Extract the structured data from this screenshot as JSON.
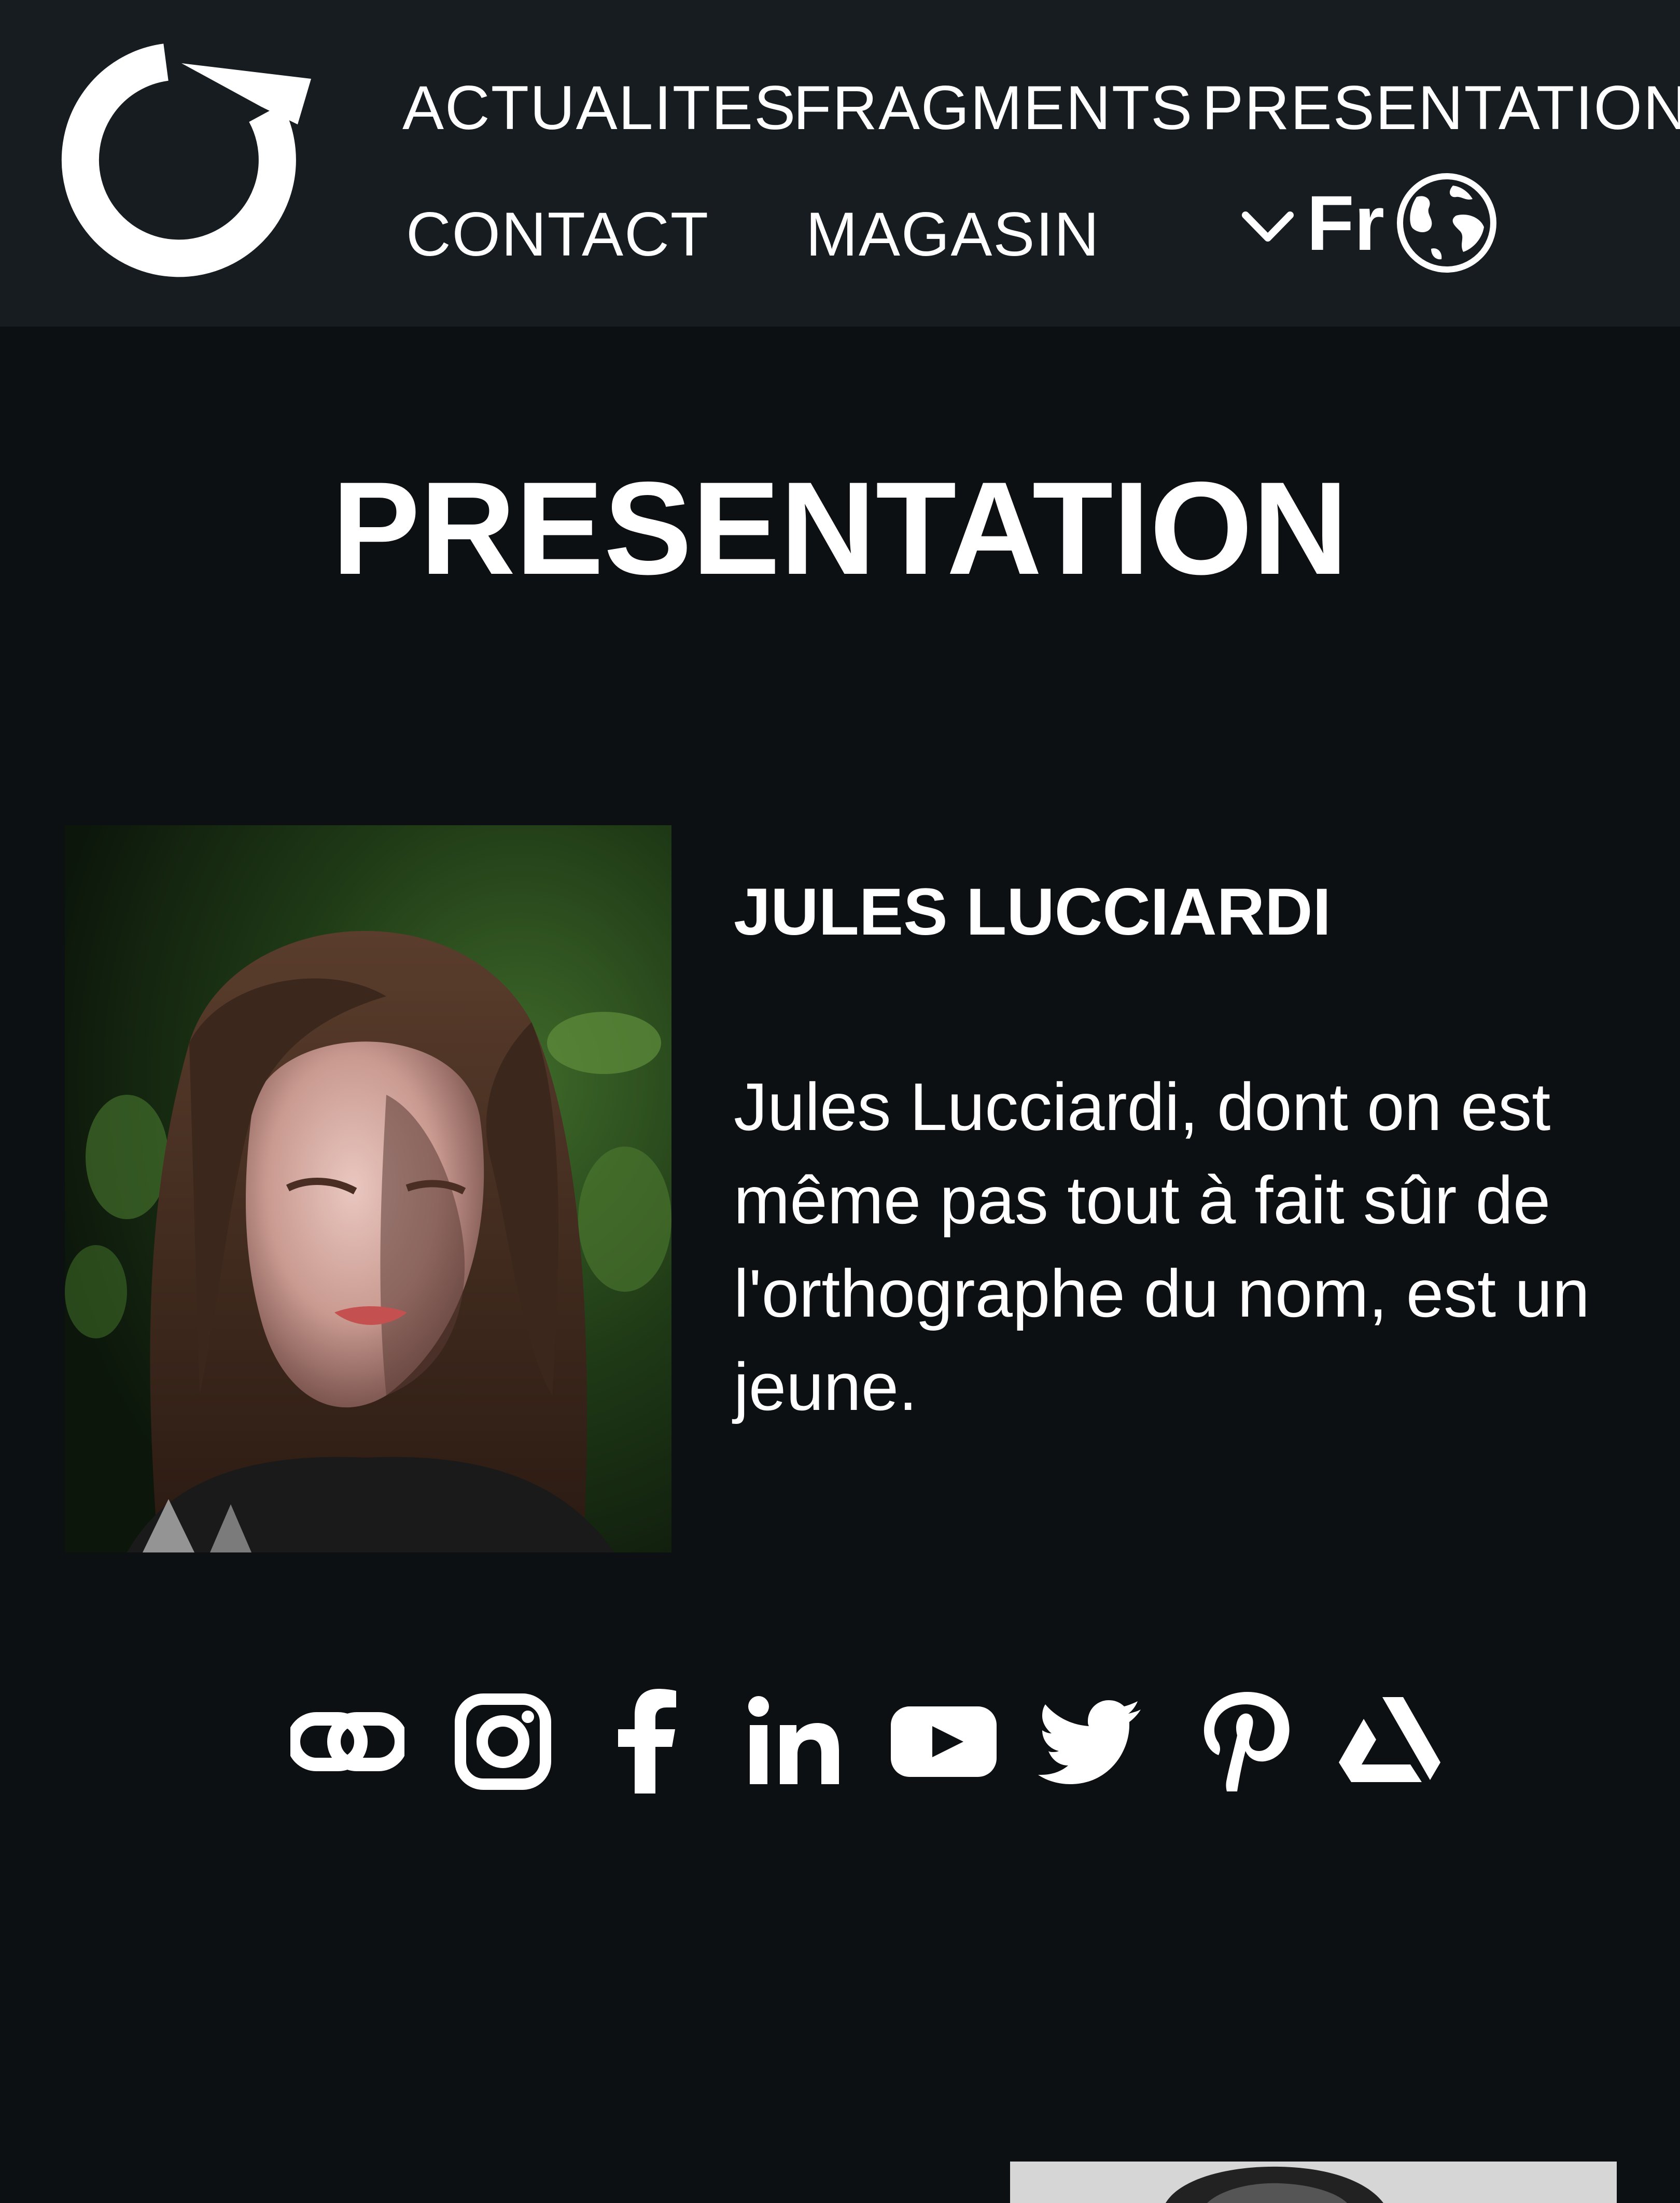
{
  "header": {
    "logo_name": "site-logo",
    "nav": [
      {
        "label": "ACTUALITES"
      },
      {
        "label": "FRAGMENTS"
      },
      {
        "label": "PRESENTATION"
      },
      {
        "label": "CONTACT"
      },
      {
        "label": "MAGASIN"
      }
    ],
    "language": {
      "label": "Fr",
      "chevron_icon": "chevron-down-icon",
      "globe_icon": "globe-icon"
    }
  },
  "main": {
    "title": "PRESENTATION",
    "profile": {
      "name": "JULES LUCCIARDI",
      "bio": "Jules Lucciardi, dont on est même pas tout à fait sûr de l'orthographe du nom, est un jeune."
    },
    "social_icons": [
      "link-icon",
      "instagram-icon",
      "facebook-icon",
      "linkedin-icon",
      "youtube-icon",
      "twitter-icon",
      "pinterest-icon",
      "artstation-icon"
    ]
  },
  "colors": {
    "background": "#0d1012",
    "header_background": "#171c20",
    "text": "#ffffff"
  }
}
